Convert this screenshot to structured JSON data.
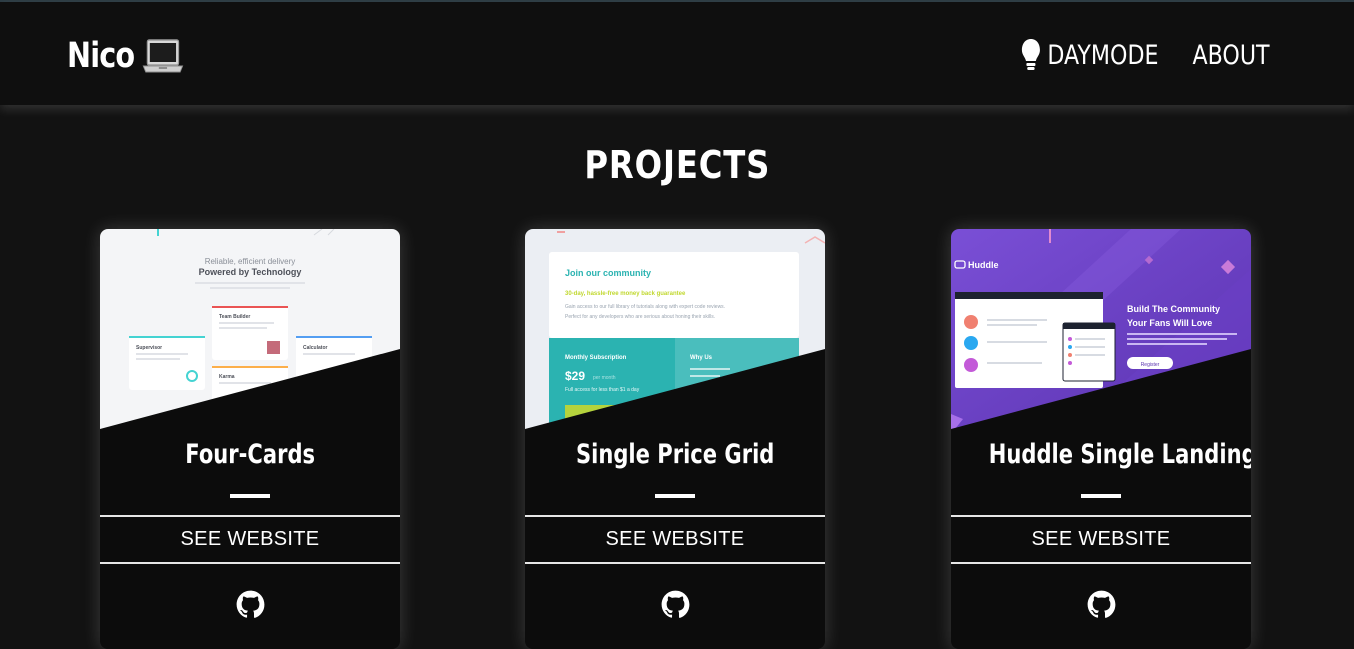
{
  "nav": {
    "brand": "Nico",
    "brand_icon": "laptop-icon",
    "daymode_label": "DAYMODE",
    "daymode_icon": "lightbulb-icon",
    "about_label": "ABOUT"
  },
  "page": {
    "title": "PROJECTS"
  },
  "projects": [
    {
      "title": "Four-Cards",
      "link_label": "SEE WEBSITE",
      "repo_icon": "github-icon",
      "thumb": {
        "line1": "Reliable, efficient delivery",
        "line2": "Powered by Technology",
        "cards": [
          "Supervisor",
          "Team Builder",
          "Karma",
          "Calculator"
        ]
      }
    },
    {
      "title": "Single Price Grid",
      "link_label": "SEE WEBSITE",
      "repo_icon": "github-icon",
      "thumb": {
        "heading": "Join our community",
        "sub": "30-day, hassle-free money back guarantee",
        "body1": "Gain access to our full library of tutorials along with expert code reviews.",
        "body2": "Perfect for any developers who are serious about honing their skills.",
        "sub_label": "Monthly Subscription",
        "price": "$29",
        "per": "per month",
        "price_note": "Full access for less than $1 a day",
        "why": "Why Us"
      }
    },
    {
      "title": "Huddle Single Landing",
      "link_label": "SEE WEBSITE",
      "repo_icon": "github-icon",
      "thumb": {
        "logo": "Huddle",
        "headline1": "Build The Community",
        "headline2": "Your Fans Will Love",
        "button": "Register"
      }
    }
  ],
  "colors": {
    "background": "#121212",
    "navbar": "#0f0f0f",
    "card": "#0c0c0c",
    "teal": "#3dbdbd",
    "lime": "#b5d33d",
    "huddle_purple": "#6b3fbf"
  }
}
